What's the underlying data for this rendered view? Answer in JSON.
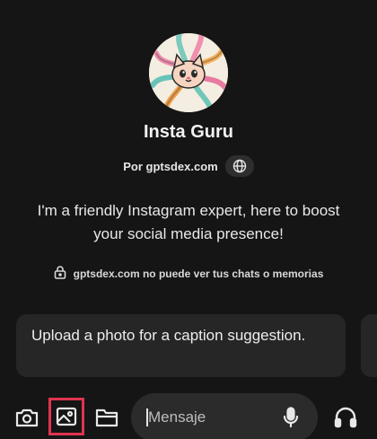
{
  "gpt": {
    "name": "Insta Guru",
    "author": "Por gptsdex.com",
    "description": "I'm a friendly Instagram expert, here to boost your social media presence!",
    "privacy_note": "gptsdex.com no puede ver tus chats o memorias"
  },
  "suggestions": [
    {
      "label": "Upload a photo for a caption suggestion."
    }
  ],
  "composer": {
    "placeholder": "Mensaje"
  },
  "icons": {
    "avatar": "cat-octopus-avatar",
    "globe": "globe-icon",
    "lock": "lock-icon",
    "camera": "camera-icon",
    "photo": "photo-icon",
    "folder": "folder-icon",
    "mic": "microphone-icon",
    "headphones": "headphones-icon"
  },
  "colors": {
    "background": "#151515",
    "card": "#262626",
    "highlight": "#e0344f"
  }
}
